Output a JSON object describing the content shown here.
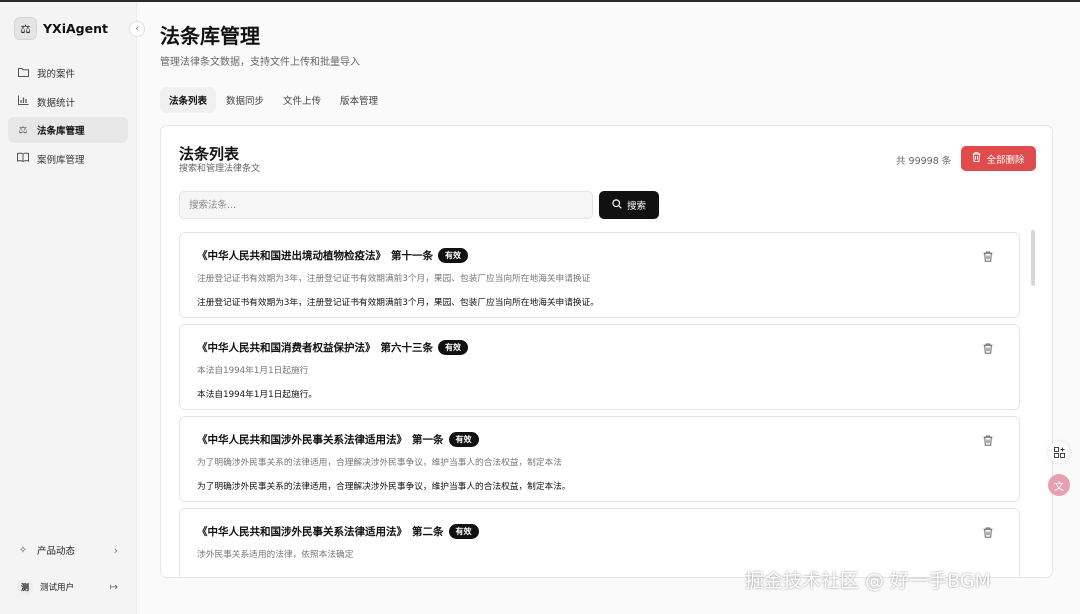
{
  "app": {
    "name": "YXiAgent",
    "logo_icon": "scale-icon"
  },
  "sidebar": {
    "collapse_icon": "chevron-left-icon",
    "items": [
      {
        "label": "我的案件",
        "icon": "folder-icon",
        "active": false
      },
      {
        "label": "数据统计",
        "icon": "bar-chart-icon",
        "active": false
      },
      {
        "label": "法条库管理",
        "icon": "scale-icon",
        "active": true
      },
      {
        "label": "案例库管理",
        "icon": "book-icon",
        "active": false
      }
    ],
    "product_news": {
      "label": "产品动态",
      "icon": "sparkle-icon"
    },
    "user": {
      "avatar_text": "测",
      "name": "测试用户",
      "logout_icon": "logout-icon"
    }
  },
  "header": {
    "title": "法条库管理",
    "subtitle": "管理法律条文数据，支持文件上传和批量导入"
  },
  "tabs": [
    {
      "label": "法条列表",
      "active": true
    },
    {
      "label": "数据同步",
      "active": false
    },
    {
      "label": "文件上传",
      "active": false
    },
    {
      "label": "版本管理",
      "active": false
    }
  ],
  "panel": {
    "title": "法条列表",
    "description": "搜索和管理法律条文",
    "count_text": "共 99998 条",
    "delete_all_label": "全部删除",
    "search": {
      "placeholder": "搜索法条...",
      "value": "",
      "button_label": "搜索"
    }
  },
  "laws": [
    {
      "title": "《中华人民共和国进出境动植物检疫法》",
      "article": "第十一条",
      "status": "有效",
      "summary": "注册登记证书有效期为3年，注册登记证书有效期满前3个月，果园、包装厂应当向所在地海关申请换证",
      "content": "注册登记证书有效期为3年，注册登记证书有效期满前3个月，果园、包装厂应当向所在地海关申请换证。"
    },
    {
      "title": "《中华人民共和国消费者权益保护法》",
      "article": "第六十三条",
      "status": "有效",
      "summary": "本法自1994年1月1日起施行",
      "content": "本法自1994年1月1日起施行。"
    },
    {
      "title": "《中华人民共和国涉外民事关系法律适用法》",
      "article": "第一条",
      "status": "有效",
      "summary": "为了明确涉外民事关系的法律适用，合理解决涉外民事争议，维护当事人的合法权益，制定本法",
      "content": "为了明确涉外民事关系的法律适用，合理解决涉外民事争议，维护当事人的合法权益，制定本法。"
    },
    {
      "title": "《中华人民共和国涉外民事关系法律适用法》",
      "article": "第二条",
      "status": "有效",
      "summary": "涉外民事关系适用的法律，依照本法确定",
      "content": ""
    }
  ],
  "floating": [
    {
      "icon": "apps-add-icon"
    },
    {
      "icon": "translate-icon"
    }
  ],
  "watermark": "掘金技术社区 @ 好一手BGM",
  "colors": {
    "accent": "#111111",
    "danger": "#e04b4b",
    "sidebar_bg": "#f4f4f5"
  }
}
